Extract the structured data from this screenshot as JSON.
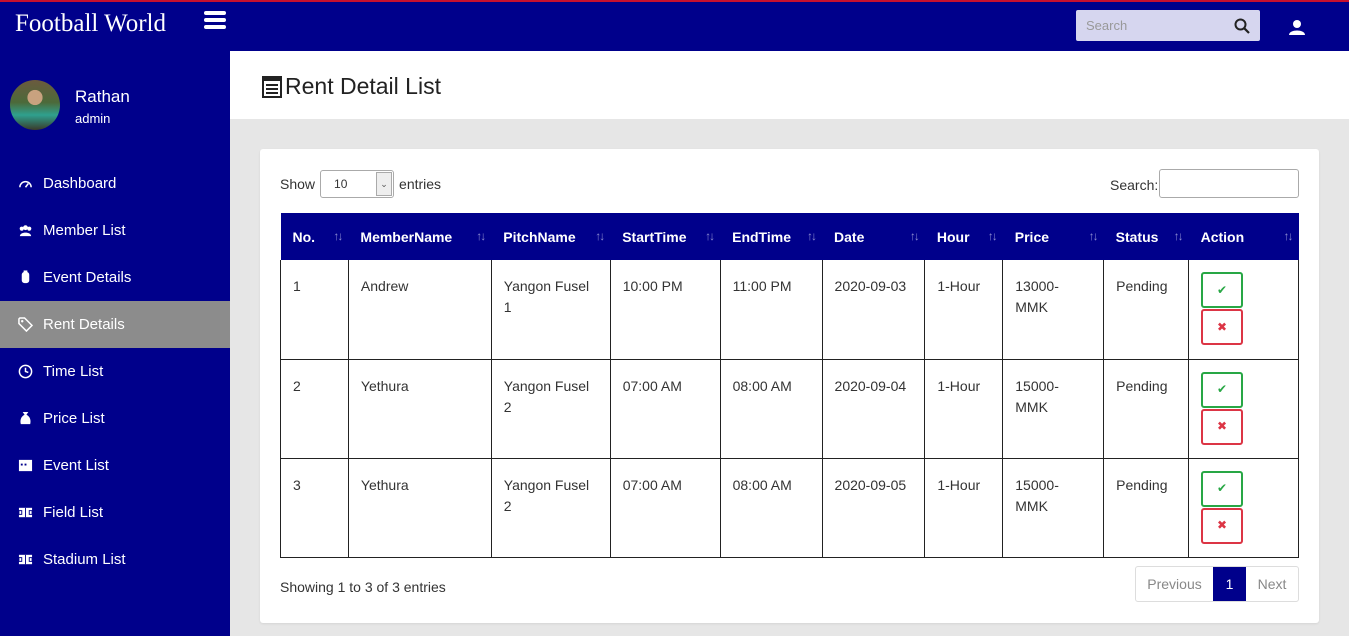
{
  "header": {
    "brand": "Football World",
    "search_placeholder": "Search"
  },
  "profile": {
    "name": "Rathan",
    "role": "admin"
  },
  "sidebar": {
    "items": [
      {
        "label": "Dashboard",
        "icon": "dashboard-icon"
      },
      {
        "label": "Member List",
        "icon": "users-icon"
      },
      {
        "label": "Event Details",
        "icon": "event-icon"
      },
      {
        "label": "Rent Details",
        "icon": "tag-icon"
      },
      {
        "label": "Time List",
        "icon": "clock-icon"
      },
      {
        "label": "Price List",
        "icon": "money-bag-icon"
      },
      {
        "label": "Event List",
        "icon": "calendar-icon"
      },
      {
        "label": "Field List",
        "icon": "field-icon"
      },
      {
        "label": "Stadium List",
        "icon": "stadium-icon"
      }
    ],
    "active_index": 3
  },
  "page": {
    "title": "Rent Detail List"
  },
  "table_controls": {
    "show_label": "Show",
    "entries_value": "10",
    "entries_label": "entries",
    "search_label": "Search:"
  },
  "table": {
    "columns": [
      "No.",
      "MemberName",
      "PitchName",
      "StartTime",
      "EndTime",
      "Date",
      "Hour",
      "Price",
      "Status",
      "Action"
    ],
    "rows": [
      {
        "no": "1",
        "member": "Andrew",
        "pitch": "Yangon Fusel 1",
        "start": "10:00 PM",
        "end": "11:00 PM",
        "date": "2020-09-03",
        "hour": "1-Hour",
        "price_line1": "13000-",
        "price_line2": "MMK",
        "status": "Pending"
      },
      {
        "no": "2",
        "member": "Yethura",
        "pitch": "Yangon Fusel 2",
        "start": "07:00 AM",
        "end": "08:00 AM",
        "date": "2020-09-04",
        "hour": "1-Hour",
        "price_line1": "15000-",
        "price_line2": "MMK",
        "status": "Pending"
      },
      {
        "no": "3",
        "member": "Yethura",
        "pitch": "Yangon Fusel 2",
        "start": "07:00 AM",
        "end": "08:00 AM",
        "date": "2020-09-05",
        "hour": "1-Hour",
        "price_line1": "15000-",
        "price_line2": "MMK",
        "status": "Pending"
      }
    ]
  },
  "footer": {
    "info": "Showing 1 to 3 of 3 entries",
    "previous": "Previous",
    "current_page": "1",
    "next": "Next"
  },
  "colors": {
    "primary": "#00008b",
    "active_item": "#8c8c8c",
    "accept": "#28a745",
    "reject": "#dc3545"
  }
}
